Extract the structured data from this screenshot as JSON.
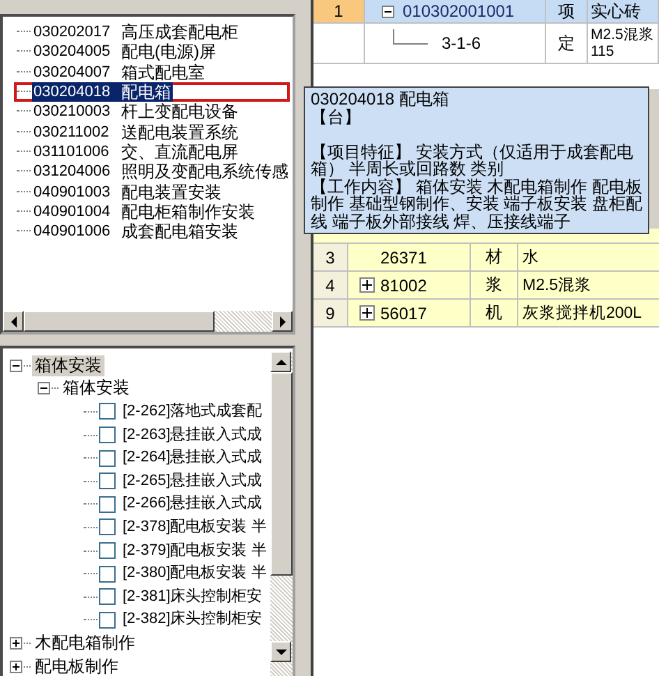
{
  "code_list": {
    "items": [
      {
        "code": "030202017",
        "name": "高压成套配电柜",
        "selected": false
      },
      {
        "code": "030204005",
        "name": "配电(电源)屏",
        "selected": false
      },
      {
        "code": "030204007",
        "name": "箱式配电室",
        "selected": false
      },
      {
        "code": "030204018",
        "name": "配电箱",
        "selected": true
      },
      {
        "code": "030210003",
        "name": "杆上变配电设备",
        "selected": false
      },
      {
        "code": "030211002",
        "name": "送配电装置系统",
        "selected": false
      },
      {
        "code": "031101006",
        "name": "交、直流配电屏",
        "selected": false
      },
      {
        "code": "031204006",
        "name": "照明及变配电系统传感",
        "selected": false
      },
      {
        "code": "040901003",
        "name": "配电装置安装",
        "selected": false
      },
      {
        "code": "040901004",
        "name": "配电柜箱制作安装",
        "selected": false
      },
      {
        "code": "040901006",
        "name": "成套配电箱安装",
        "selected": false
      }
    ]
  },
  "item_tree": {
    "items": [
      {
        "kind": "node",
        "label": "箱体安装",
        "expanded": true,
        "selected": true,
        "children": [
          {
            "kind": "node",
            "label": "箱体安装",
            "expanded": true,
            "selected": false,
            "children": [
              {
                "label": "[2-262]落地式成套配",
                "checked": false
              },
              {
                "label": "[2-263]悬挂嵌入式成",
                "checked": false
              },
              {
                "label": "[2-264]悬挂嵌入式成",
                "checked": false
              },
              {
                "label": "[2-265]悬挂嵌入式成",
                "checked": false
              },
              {
                "label": "[2-266]悬挂嵌入式成",
                "checked": false
              },
              {
                "label": "[2-378]配电板安装 半",
                "checked": false
              },
              {
                "label": "[2-379]配电板安装 半",
                "checked": false
              },
              {
                "label": "[2-380]配电板安装 半",
                "checked": false
              },
              {
                "label": "[2-381]床头控制柜安",
                "checked": false
              },
              {
                "label": "[2-382]床头控制柜安",
                "checked": false
              }
            ]
          }
        ]
      },
      {
        "kind": "node",
        "label": "木配电箱制作",
        "expanded": false,
        "selected": false
      },
      {
        "kind": "node",
        "label": "配电板制作",
        "expanded": false,
        "selected": false
      }
    ]
  },
  "top_grid": {
    "rows": [
      {
        "number": "1",
        "selected": true,
        "expanded": true,
        "code": "010302001001",
        "type": "项",
        "name": "实心砖",
        "children": [
          {
            "code": "3-1-6",
            "type": "定",
            "name": "M2.5混浆\n115"
          }
        ]
      }
    ]
  },
  "resource_grid": {
    "rows": [
      {
        "number": "3",
        "expandable": false,
        "code": "26371",
        "type": "材",
        "name": "水"
      },
      {
        "number": "4",
        "expandable": true,
        "code": "81002",
        "type": "浆",
        "name": "M2.5混浆"
      },
      {
        "number": "9",
        "expandable": true,
        "code": "56017",
        "type": "机",
        "name": "灰浆搅拌机200L"
      }
    ]
  },
  "tooltip": {
    "title": "030204018 配电箱",
    "unit": "【台】",
    "lines": [
      "【项目特征】 安装方式（仅适用于成套配电箱） 半周长或回路数 类别",
      "【工作内容】 箱体安装 木配电箱制作 配电板制作 基础型钢制作、安装 端子板安装 盘柜配线 端子板外部接线 焊、压接线端子"
    ]
  }
}
